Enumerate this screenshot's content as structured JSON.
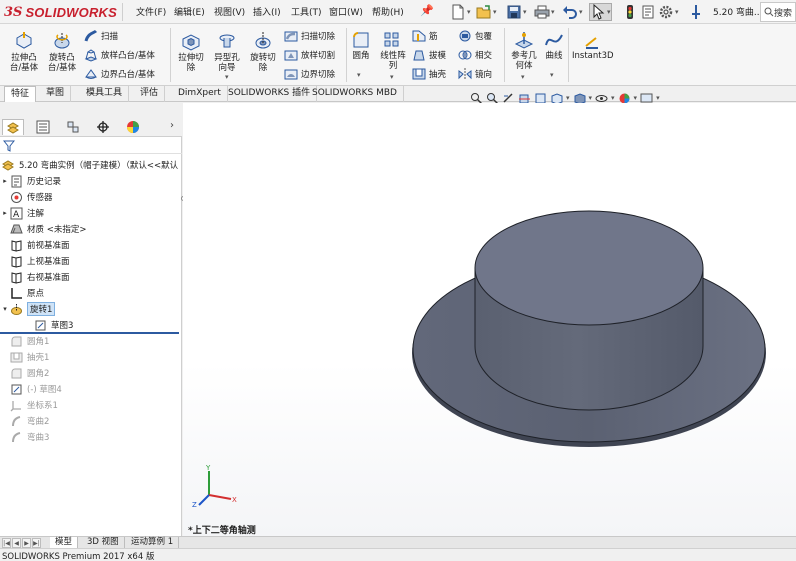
{
  "app": {
    "logo_ds": "3S",
    "logo_text": "SOLIDWORKS",
    "brand_color": "#c8202e",
    "document_title": "5.20 弯曲...",
    "search_placeholder": "搜索"
  },
  "menu": [
    "文件(F)",
    "编辑(E)",
    "视图(V)",
    "插入(I)",
    "工具(T)",
    "窗口(W)",
    "帮助(H)"
  ],
  "commands": {
    "extrude_boss": "拉伸凸\n台/基体",
    "revolve_boss": "旋转凸\n台/基体",
    "sweep": "扫描",
    "loft_boss": "放样凸台/基体",
    "boundary_boss": "边界凸台/基体",
    "extrude_cut": "拉伸切\n除",
    "hole_wizard": "异型孔\n向导",
    "revolve_cut": "旋转切\n除",
    "sweep_cut": "扫描切除",
    "loft_cut": "放样切割",
    "boundary_cut": "边界切除",
    "fillet": "圆角",
    "linear_pattern": "线性阵\n列",
    "rib": "筋",
    "draft": "拔模",
    "shell": "抽壳",
    "wrap": "包覆",
    "intersect": "相交",
    "mirror": "镜向",
    "reference_geometry": "参考几\n何体",
    "curves": "曲线",
    "instant3d": "Instant3D"
  },
  "tabs": [
    "特征",
    "草图",
    "模具工具",
    "评估",
    "DimXpert",
    "SOLIDWORKS 插件",
    "SOLIDWORKS MBD"
  ],
  "active_tab": "特征",
  "tree": {
    "root": "5.20 弯曲实例（帽子建模）（默认<<默认",
    "items": [
      {
        "label": "历史记录",
        "icon": "history-icon",
        "expandable": true,
        "dim": false
      },
      {
        "label": "传感器",
        "icon": "sensor-icon",
        "expandable": false,
        "dim": false
      },
      {
        "label": "注解",
        "icon": "annotation-icon",
        "expandable": true,
        "dim": false
      },
      {
        "label": "材质 <未指定>",
        "icon": "material-icon",
        "expandable": false,
        "dim": false
      },
      {
        "label": "前视基准面",
        "icon": "plane-icon",
        "expandable": false,
        "dim": false
      },
      {
        "label": "上视基准面",
        "icon": "plane-icon",
        "expandable": false,
        "dim": false
      },
      {
        "label": "右视基准面",
        "icon": "plane-icon",
        "expandable": false,
        "dim": false
      },
      {
        "label": "原点",
        "icon": "origin-icon",
        "expandable": false,
        "dim": false
      },
      {
        "label": "旋转1",
        "icon": "revolve-icon",
        "expandable": true,
        "dim": false,
        "selected": true
      },
      {
        "label": "草图3",
        "icon": "sketch-icon",
        "expandable": false,
        "dim": false,
        "child": true
      },
      {
        "label": "圆角1",
        "icon": "fillet-icon",
        "expandable": false,
        "dim": true
      },
      {
        "label": "抽壳1",
        "icon": "shell-icon",
        "expandable": false,
        "dim": true
      },
      {
        "label": "圆角2",
        "icon": "fillet-icon",
        "expandable": false,
        "dim": true
      },
      {
        "label": "(-) 草图4",
        "icon": "sketch-icon",
        "expandable": false,
        "dim": true
      },
      {
        "label": "坐标系1",
        "icon": "coordinate-icon",
        "expandable": false,
        "dim": true
      },
      {
        "label": "弯曲2",
        "icon": "flex-icon",
        "expandable": false,
        "dim": true
      },
      {
        "label": "弯曲3",
        "icon": "flex-icon",
        "expandable": false,
        "dim": true
      }
    ]
  },
  "viewport": {
    "view_name": "*上下二等角轴测",
    "model_color": "#5d6373",
    "axis_labels": {
      "x": "X",
      "y": "Y",
      "z": "Z"
    }
  },
  "bottom_tabs": [
    "模型",
    "3D 视图",
    "运动算例 1"
  ],
  "active_bottom_tab": "模型",
  "status": "SOLIDWORKS Premium 2017 x64 版"
}
